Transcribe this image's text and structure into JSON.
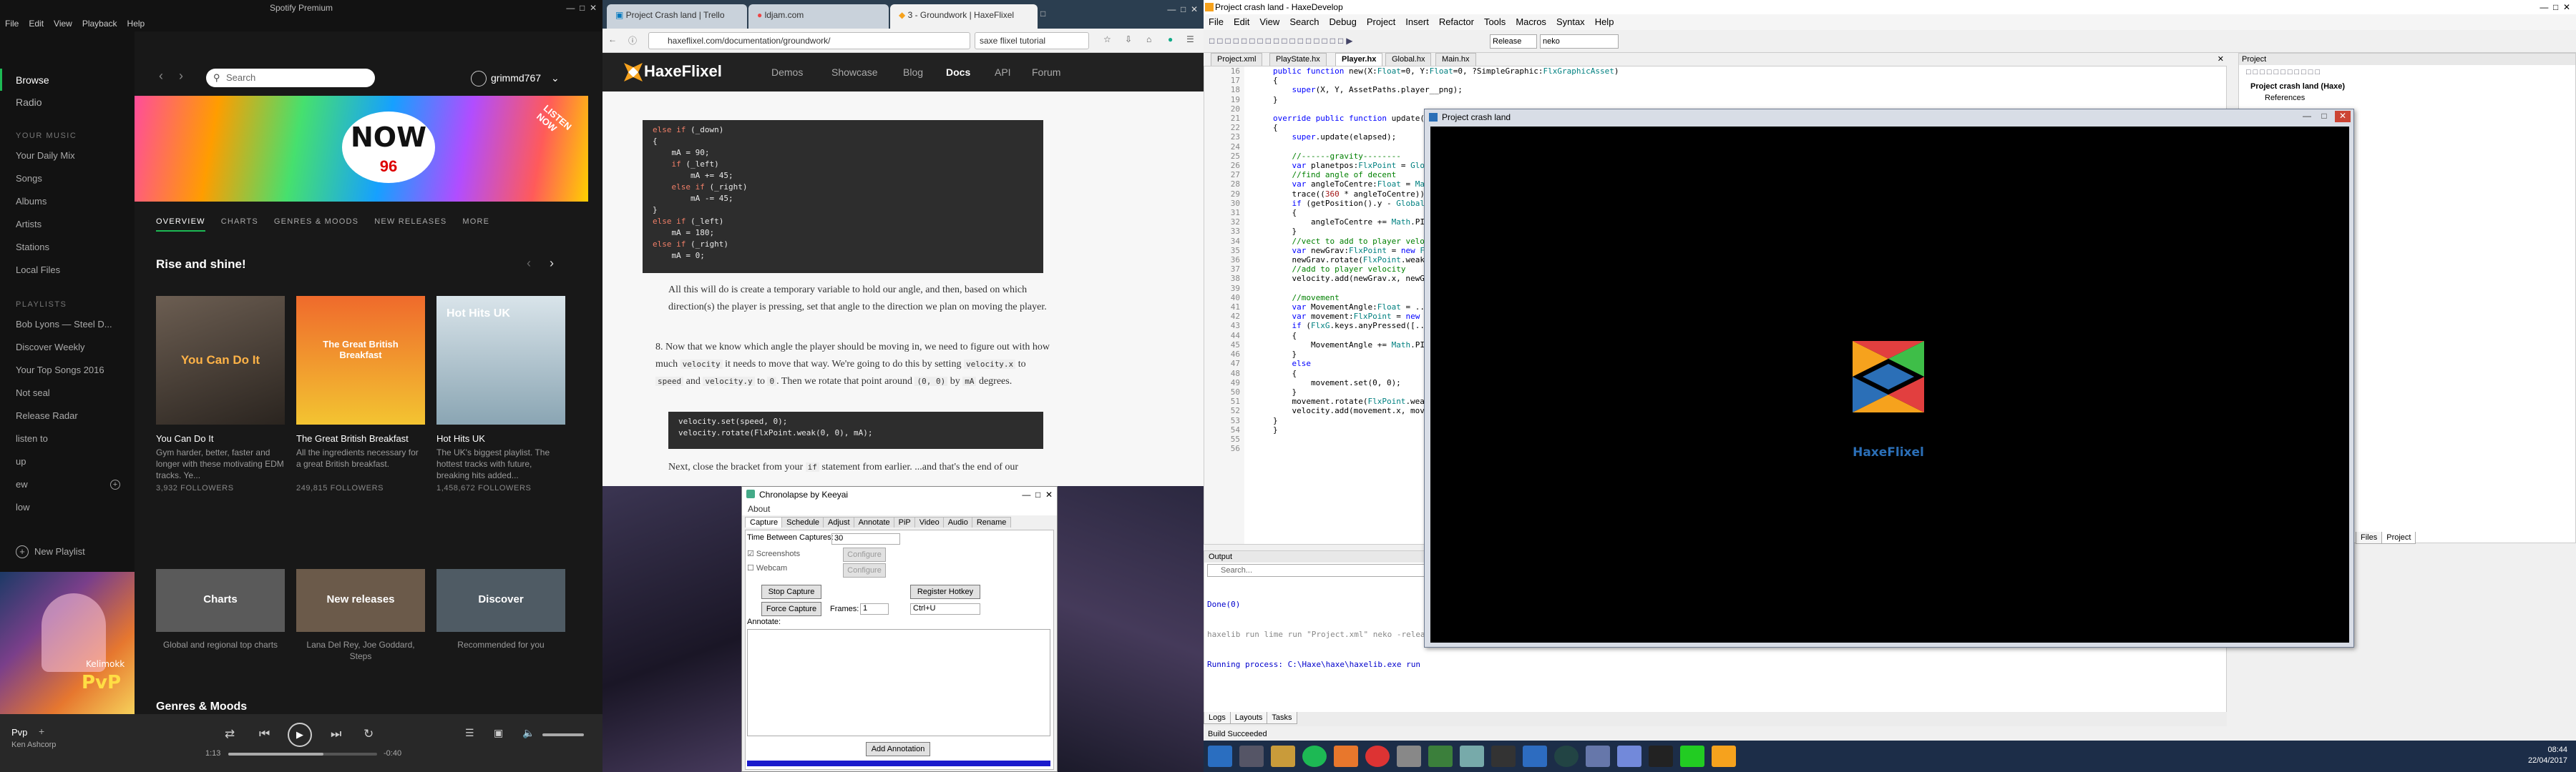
{
  "spotify": {
    "title": "Spotify Premium",
    "menu": [
      "File",
      "Edit",
      "View",
      "Playback",
      "Help"
    ],
    "nav": [
      "Browse",
      "Radio"
    ],
    "music_heading": "YOUR MUSIC",
    "music_items": [
      "Your Daily Mix",
      "Songs",
      "Albums",
      "Artists",
      "Stations",
      "Local Files"
    ],
    "playlists_heading": "PLAYLISTS",
    "playlists": [
      "Bob Lyons — Steel D...",
      "Discover Weekly",
      "Your Top Songs 2016",
      "Not seal",
      "Release Radar",
      "listen to",
      "up",
      "ew",
      "low"
    ],
    "new_playlist": "New Playlist",
    "search_placeholder": "Search",
    "username": "grimmd767",
    "banner_now": "NOW",
    "banner_num": "96",
    "banner_stamp": "LISTEN NOW",
    "tabs": [
      "OVERVIEW",
      "CHARTS",
      "GENRES & MOODS",
      "NEW RELEASES",
      "MORE"
    ],
    "section_title": "Rise and shine!",
    "cards": [
      {
        "label": "You Can Do It",
        "name": "You Can Do It",
        "desc": "Gym harder, better, faster and longer with these motivating EDM tracks. Ye...",
        "followers": "3,932 FOLLOWERS"
      },
      {
        "label": "The Great British Breakfast",
        "name": "The Great British Breakfast",
        "desc": "All the ingredients necessary for a great British breakfast.",
        "followers": "249,815 FOLLOWERS"
      },
      {
        "label": "Hot Hits UK",
        "name": "Hot Hits UK",
        "desc": "The UK's biggest playlist. The hottest tracks with future, breaking hits added...",
        "followers": "1,458,672 FOLLOWERS"
      }
    ],
    "cards2": [
      {
        "label": "Charts",
        "desc": "Global and regional top charts"
      },
      {
        "label": "New releases",
        "desc": "Lana Del Rey, Joe Goddard, Steps"
      },
      {
        "label": "Discover",
        "desc": "Recommended for you"
      }
    ],
    "genres_title": "Genres & Moods",
    "art_line1": "Kelimokk",
    "art_line2": "PvP",
    "now_playing": {
      "track": "Pvp",
      "artist": "Ken Ashcorp",
      "elapsed": "1:13",
      "remaining": "-0:40",
      "progress": 0.64
    }
  },
  "chrome": {
    "tabs": [
      "Project Crash land | Trello",
      "ldjam.com",
      "3 - Groundwork | HaxeFlixel"
    ],
    "url": "haxeflixel.com/documentation/groundwork/",
    "find": "saxe flixel tutorial",
    "site_name": "HaxeFlixel",
    "nav": [
      "Demos",
      "Showcase",
      "Blog",
      "Docs",
      "API",
      "Forum"
    ],
    "code1": [
      "else if (_down)",
      "{",
      "    mA = 90;",
      "    if (_left)",
      "        mA += 45;",
      "    else if (_right)",
      "        mA -= 45;",
      "}",
      "else if (_left)",
      "    mA = 180;",
      "else if (_right)",
      "    mA = 0;"
    ],
    "para1": "All this will do is create a temporary variable to hold our angle, and then, based on which direction(s) the player is pressing, set that angle to the direction we plan on moving the player.",
    "para2_num": "8.",
    "para2a": "Now that we know which angle the player should be moving in, we need to figure out with how much",
    "para2b": "it needs to move that way. We're going to do this by setting",
    "para2c": "to",
    "para2d": "and",
    "para2e": ". Then we rotate that point around",
    "para2f": "by",
    "para2g": "degrees.",
    "inl_velocity": "velocity",
    "inl_vx": "velocity.x",
    "inl_speed": "speed",
    "inl_vy": "velocity.y",
    "inl_zero": "0",
    "inl_origin": "(0, 0)",
    "inl_ma": "mA",
    "code2": [
      "velocity.set(speed, 0);",
      "velocity.rotate(FlxPoint.weak(0, 0), mA);"
    ],
    "para3a": "Next, close the bracket from your",
    "para3b": "statement from earlier. ...and that's the end of our",
    "inl_if": "if"
  },
  "chrono": {
    "title": "Chronolapse by Keeyai",
    "menu": "About",
    "tabs": [
      "Capture",
      "Schedule",
      "Adjust",
      "Annotate",
      "PiP",
      "Video",
      "Audio",
      "Rename"
    ],
    "time_between": "Time Between Captures:",
    "time_value": "30",
    "screenshots": "Screenshots",
    "webcam": "Webcam",
    "configure": "Configure",
    "stop": "Stop Capture",
    "register": "Register Hotkey",
    "force": "Force Capture",
    "frames_label": "Frames:",
    "frames_value": "1",
    "hotkey": "Ctrl+U",
    "annotate_label": "Annotate:",
    "add_annotation": "Add Annotation"
  },
  "haxe": {
    "title": "Project crash land - HaxeDevelop",
    "menu": [
      "File",
      "Edit",
      "View",
      "Search",
      "Debug",
      "Project",
      "Insert",
      "Refactor",
      "Tools",
      "Macros",
      "Syntax",
      "Help"
    ],
    "build_config": "Release",
    "target": "neko",
    "doc_tabs": [
      "Project.xml",
      "PlayState.hx",
      "Player.hx",
      "Global.hx",
      "Main.hx"
    ],
    "active_doc": 2,
    "gutter": "16\n17\n18\n19\n20\n21\n22\n23\n24\n25\n26\n27\n28\n29\n30\n31\n32\n33\n34\n35\n36\n37\n38\n39\n40\n41\n42\n43\n44\n45\n46\n47\n48\n49\n50\n51\n52\n53\n54\n55\n56",
    "project_panel": "Project",
    "project_root": "Project crash land (Haxe)",
    "project_refs": "References",
    "files_tab": "Files",
    "project_tab": "Project",
    "output_head": "Output",
    "output_search": "Search...",
    "output_lines": [
      "Done(0)",
      "haxelib run lime run \"Project.xml\" neko -relea",
      "Running process: C:\\Haxe\\haxe\\haxelib.exe run"
    ],
    "bottom_tabs": [
      "Logs",
      "Layouts",
      "Tasks"
    ],
    "status": "Build Succeeded",
    "clock_time": "08:44",
    "clock_date": "22/04/2017",
    "game_title": "Project crash land",
    "game_logo_text": "HaxeFlixel",
    "colors": {
      "haxe_orange": "#f6a21d",
      "haxe_blue": "#2b6fb7",
      "haxe_red": "#e23f3f",
      "haxe_green": "#3ebe48"
    }
  }
}
